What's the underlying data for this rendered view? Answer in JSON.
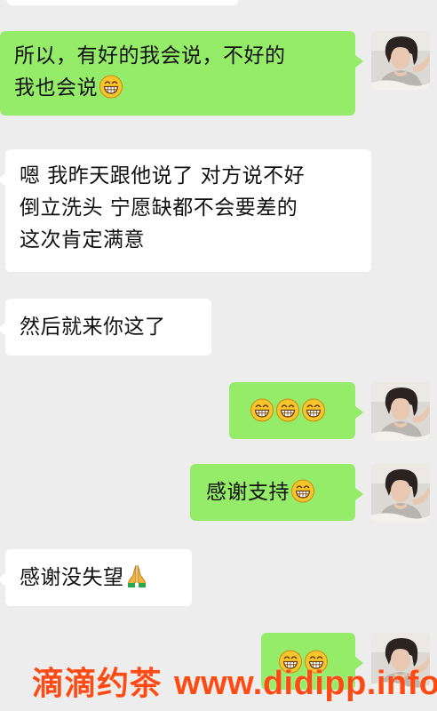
{
  "chat": {
    "messages": [
      {
        "side": "right",
        "lines": [
          "所以，有好的我会说，不好的",
          "我也会说"
        ],
        "emoji_after": "grin"
      },
      {
        "side": "left",
        "lines": [
          "嗯 我昨天跟他说了 对方说不好",
          "倒立洗头 宁愿缺都不会要差的",
          "这次肯定满意"
        ]
      },
      {
        "side": "left",
        "lines": [
          "然后就来你这了"
        ]
      },
      {
        "side": "right",
        "emoji_only": [
          "grin",
          "grin",
          "grin"
        ]
      },
      {
        "side": "right",
        "lines": [
          "感谢支持"
        ],
        "emoji_after": "grin"
      },
      {
        "side": "left",
        "lines": [
          "感谢没失望"
        ],
        "emoji_after": "folded-hands"
      },
      {
        "side": "right",
        "emoji_only": [
          "grin",
          "grin"
        ]
      }
    ]
  },
  "watermark": {
    "cn": "滴滴约茶",
    "url": "www.didipp.info"
  },
  "colors": {
    "background": "#ededed",
    "my_bubble": "#95ec69",
    "their_bubble": "#ffffff",
    "watermark": "#ff4a14"
  },
  "icons": {
    "grin": "grinning-face-emoji",
    "folded_hands": "folded-hands-emoji"
  }
}
